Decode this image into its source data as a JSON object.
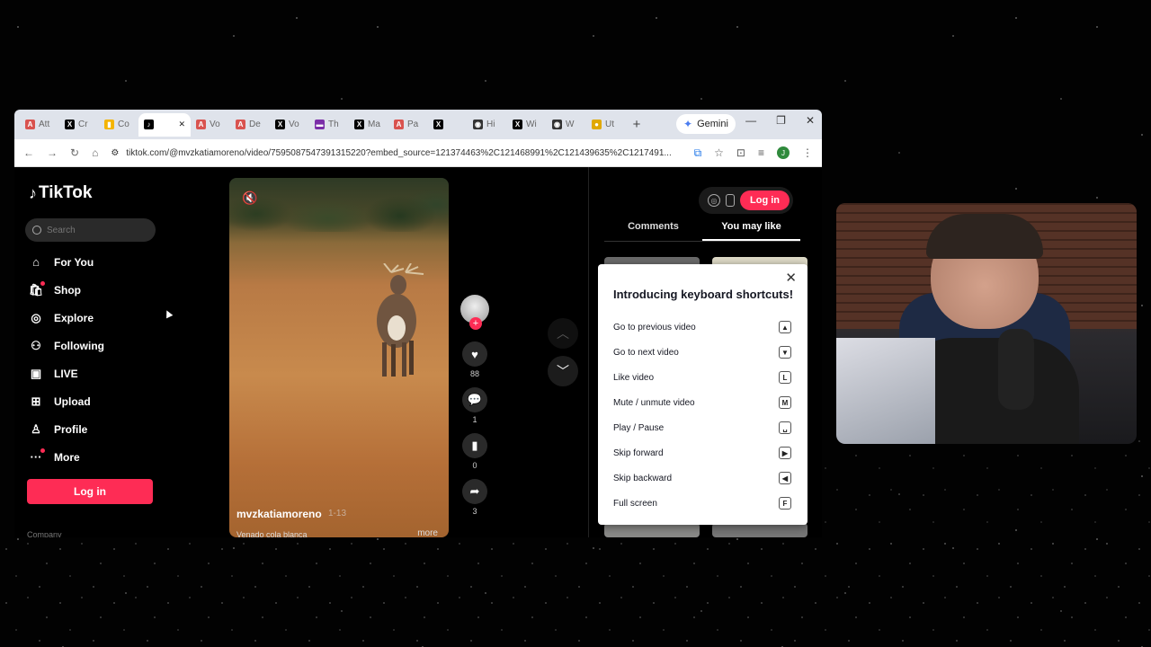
{
  "browser": {
    "tabs": [
      {
        "label": "Att",
        "icon": "a-icon",
        "color": "#d9534f",
        "active": false
      },
      {
        "label": "Cr",
        "icon": "x-icon",
        "color": "#000000",
        "active": false
      },
      {
        "label": "Co",
        "icon": "doc-icon",
        "color": "#f4b400",
        "active": false
      },
      {
        "label": "",
        "icon": "tiktok-icon",
        "color": "#000000",
        "active": true
      },
      {
        "label": "Vo",
        "icon": "a-icon",
        "color": "#d9534f",
        "active": false
      },
      {
        "label": "De",
        "icon": "a-icon",
        "color": "#d9534f",
        "active": false
      },
      {
        "label": "Vo",
        "icon": "x-icon",
        "color": "#000000",
        "active": false
      },
      {
        "label": "Th",
        "icon": "news-icon",
        "color": "#7b2ea8",
        "active": false
      },
      {
        "label": "Ma",
        "icon": "x-icon",
        "color": "#000000",
        "active": false
      },
      {
        "label": "Pa",
        "icon": "a-icon",
        "color": "#d9534f",
        "active": false
      },
      {
        "label": "",
        "icon": "x-icon",
        "color": "#000000",
        "active": false
      },
      {
        "label": "Hi",
        "icon": "chatgpt-icon",
        "color": "#333333",
        "active": false
      },
      {
        "label": "Wi",
        "icon": "x-icon",
        "color": "#000000",
        "active": false
      },
      {
        "label": "W",
        "icon": "chatgpt-icon",
        "color": "#333333",
        "active": false
      },
      {
        "label": "Ut",
        "icon": "coin-icon",
        "color": "#e0a800",
        "active": false
      }
    ],
    "gemini_label": "Gemini",
    "url": "tiktok.com/@mvzkatiamoreno/video/7595087547391315220?embed_source=121374463%2C121468991%2C121439635%2C1217491..."
  },
  "sidebar": {
    "logo_text": "TikTok",
    "search_placeholder": "Search",
    "nav": [
      {
        "label": "For You",
        "icon": "home-icon",
        "glyph": "⌂"
      },
      {
        "label": "Shop",
        "icon": "shop-icon",
        "glyph": "🛍"
      },
      {
        "label": "Explore",
        "icon": "compass-icon",
        "glyph": "◎"
      },
      {
        "label": "Following",
        "icon": "following-icon",
        "glyph": "⚇"
      },
      {
        "label": "LIVE",
        "icon": "live-icon",
        "glyph": "▣"
      },
      {
        "label": "Upload",
        "icon": "upload-icon",
        "glyph": "⊞"
      },
      {
        "label": "Profile",
        "icon": "profile-icon",
        "glyph": "♙"
      },
      {
        "label": "More",
        "icon": "more-icon",
        "glyph": "···"
      }
    ],
    "login_label": "Log in",
    "company_label": "Company"
  },
  "video": {
    "username": "mvzkatiamoreno",
    "date": "1-13",
    "description": "Venado cola blanca",
    "more_label": "more",
    "likes": "88",
    "comments": "1",
    "saves": "0",
    "shares": "3"
  },
  "right_panel": {
    "login_label": "Log in",
    "tabs": [
      "Comments",
      "You may like"
    ],
    "active_tab": "You may like"
  },
  "shortcuts_modal": {
    "title": "Introducing keyboard shortcuts!",
    "items": [
      {
        "label": "Go to previous video",
        "key": "▲"
      },
      {
        "label": "Go to next video",
        "key": "▼"
      },
      {
        "label": "Like video",
        "key": "L"
      },
      {
        "label": "Mute / unmute video",
        "key": "M"
      },
      {
        "label": "Play / Pause",
        "key": "␣"
      },
      {
        "label": "Skip forward",
        "key": "▶"
      },
      {
        "label": "Skip backward",
        "key": "◀"
      },
      {
        "label": "Full screen",
        "key": "F"
      }
    ]
  },
  "colors": {
    "accent": "#fe2c55",
    "panel_bg": "#000000",
    "modal_bg": "#ffffff"
  }
}
